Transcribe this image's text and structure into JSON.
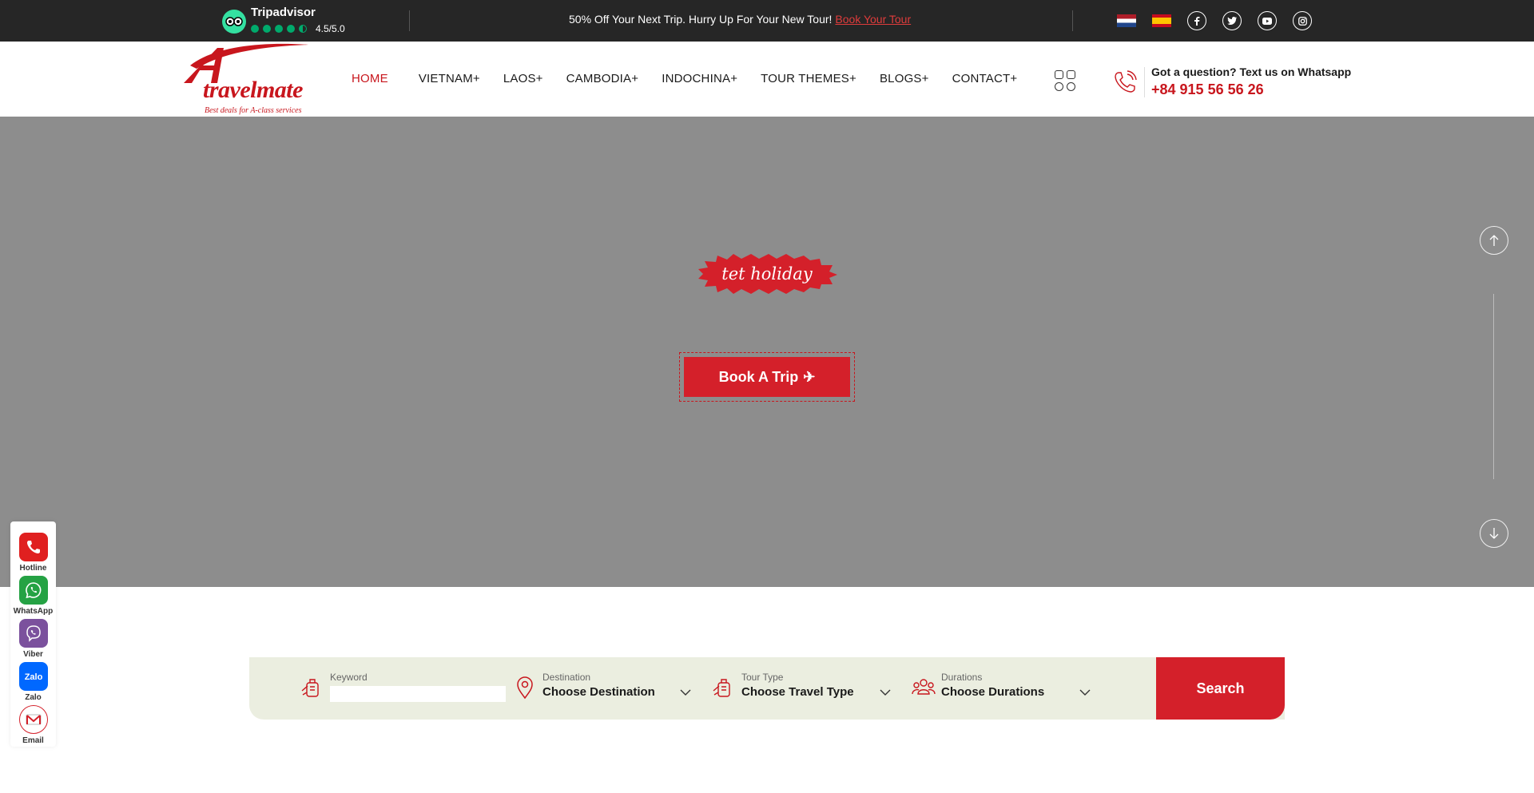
{
  "topbar": {
    "tripadvisor": {
      "name": "Tripadvisor",
      "score": "4.5/5.0",
      "rating": 4.5
    },
    "promo": {
      "text": "50% Off Your Next Trip. Hurry Up For Your New Tour!",
      "link": "Book Your Tour"
    },
    "flags": [
      "flag-netherlands",
      "flag-spain"
    ],
    "socials": [
      "facebook-icon",
      "twitter-icon",
      "youtube-icon",
      "instagram-icon"
    ]
  },
  "header": {
    "logo": {
      "word": "travelmate",
      "tagline": "Best deals for A-class services"
    },
    "nav": [
      "HOME",
      "VIETNAM+",
      "LAOS+",
      "CAMBODIA+",
      "INDOCHINA+",
      "TOUR THEMES+",
      "BLOGS+",
      "CONTACT+"
    ],
    "contact": {
      "question": "Got a question? Text us on Whatsapp",
      "phone": "+84 915 56 56 26"
    }
  },
  "hero": {
    "badge": "tet holiday",
    "book_button": "Book A Trip"
  },
  "search": {
    "keyword": {
      "label": "Keyword",
      "value": ""
    },
    "destination": {
      "label": "Destination",
      "value": "Choose Destination"
    },
    "tour_type": {
      "label": "Tour Type",
      "value": "Choose Travel Type"
    },
    "durations": {
      "label": "Durations",
      "value": "Choose Durations"
    },
    "button": "Search"
  },
  "contacts": [
    {
      "label": "Hotline",
      "icon": "phone-icon",
      "color": "#e02020"
    },
    {
      "label": "WhatsApp",
      "icon": "whatsapp-icon",
      "color": "#25a244"
    },
    {
      "label": "Viber",
      "icon": "viber-icon",
      "color": "#7b519d"
    },
    {
      "label": "Zalo",
      "icon": "zalo-icon",
      "color": "#0068ff"
    },
    {
      "label": "Email",
      "icon": "email-icon",
      "color": "#ffffff"
    }
  ],
  "colors": {
    "brand_red": "#d4202a",
    "topbar": "#262626",
    "hero_bg": "#8d8d8d",
    "search_bg": "#ebeee0"
  }
}
